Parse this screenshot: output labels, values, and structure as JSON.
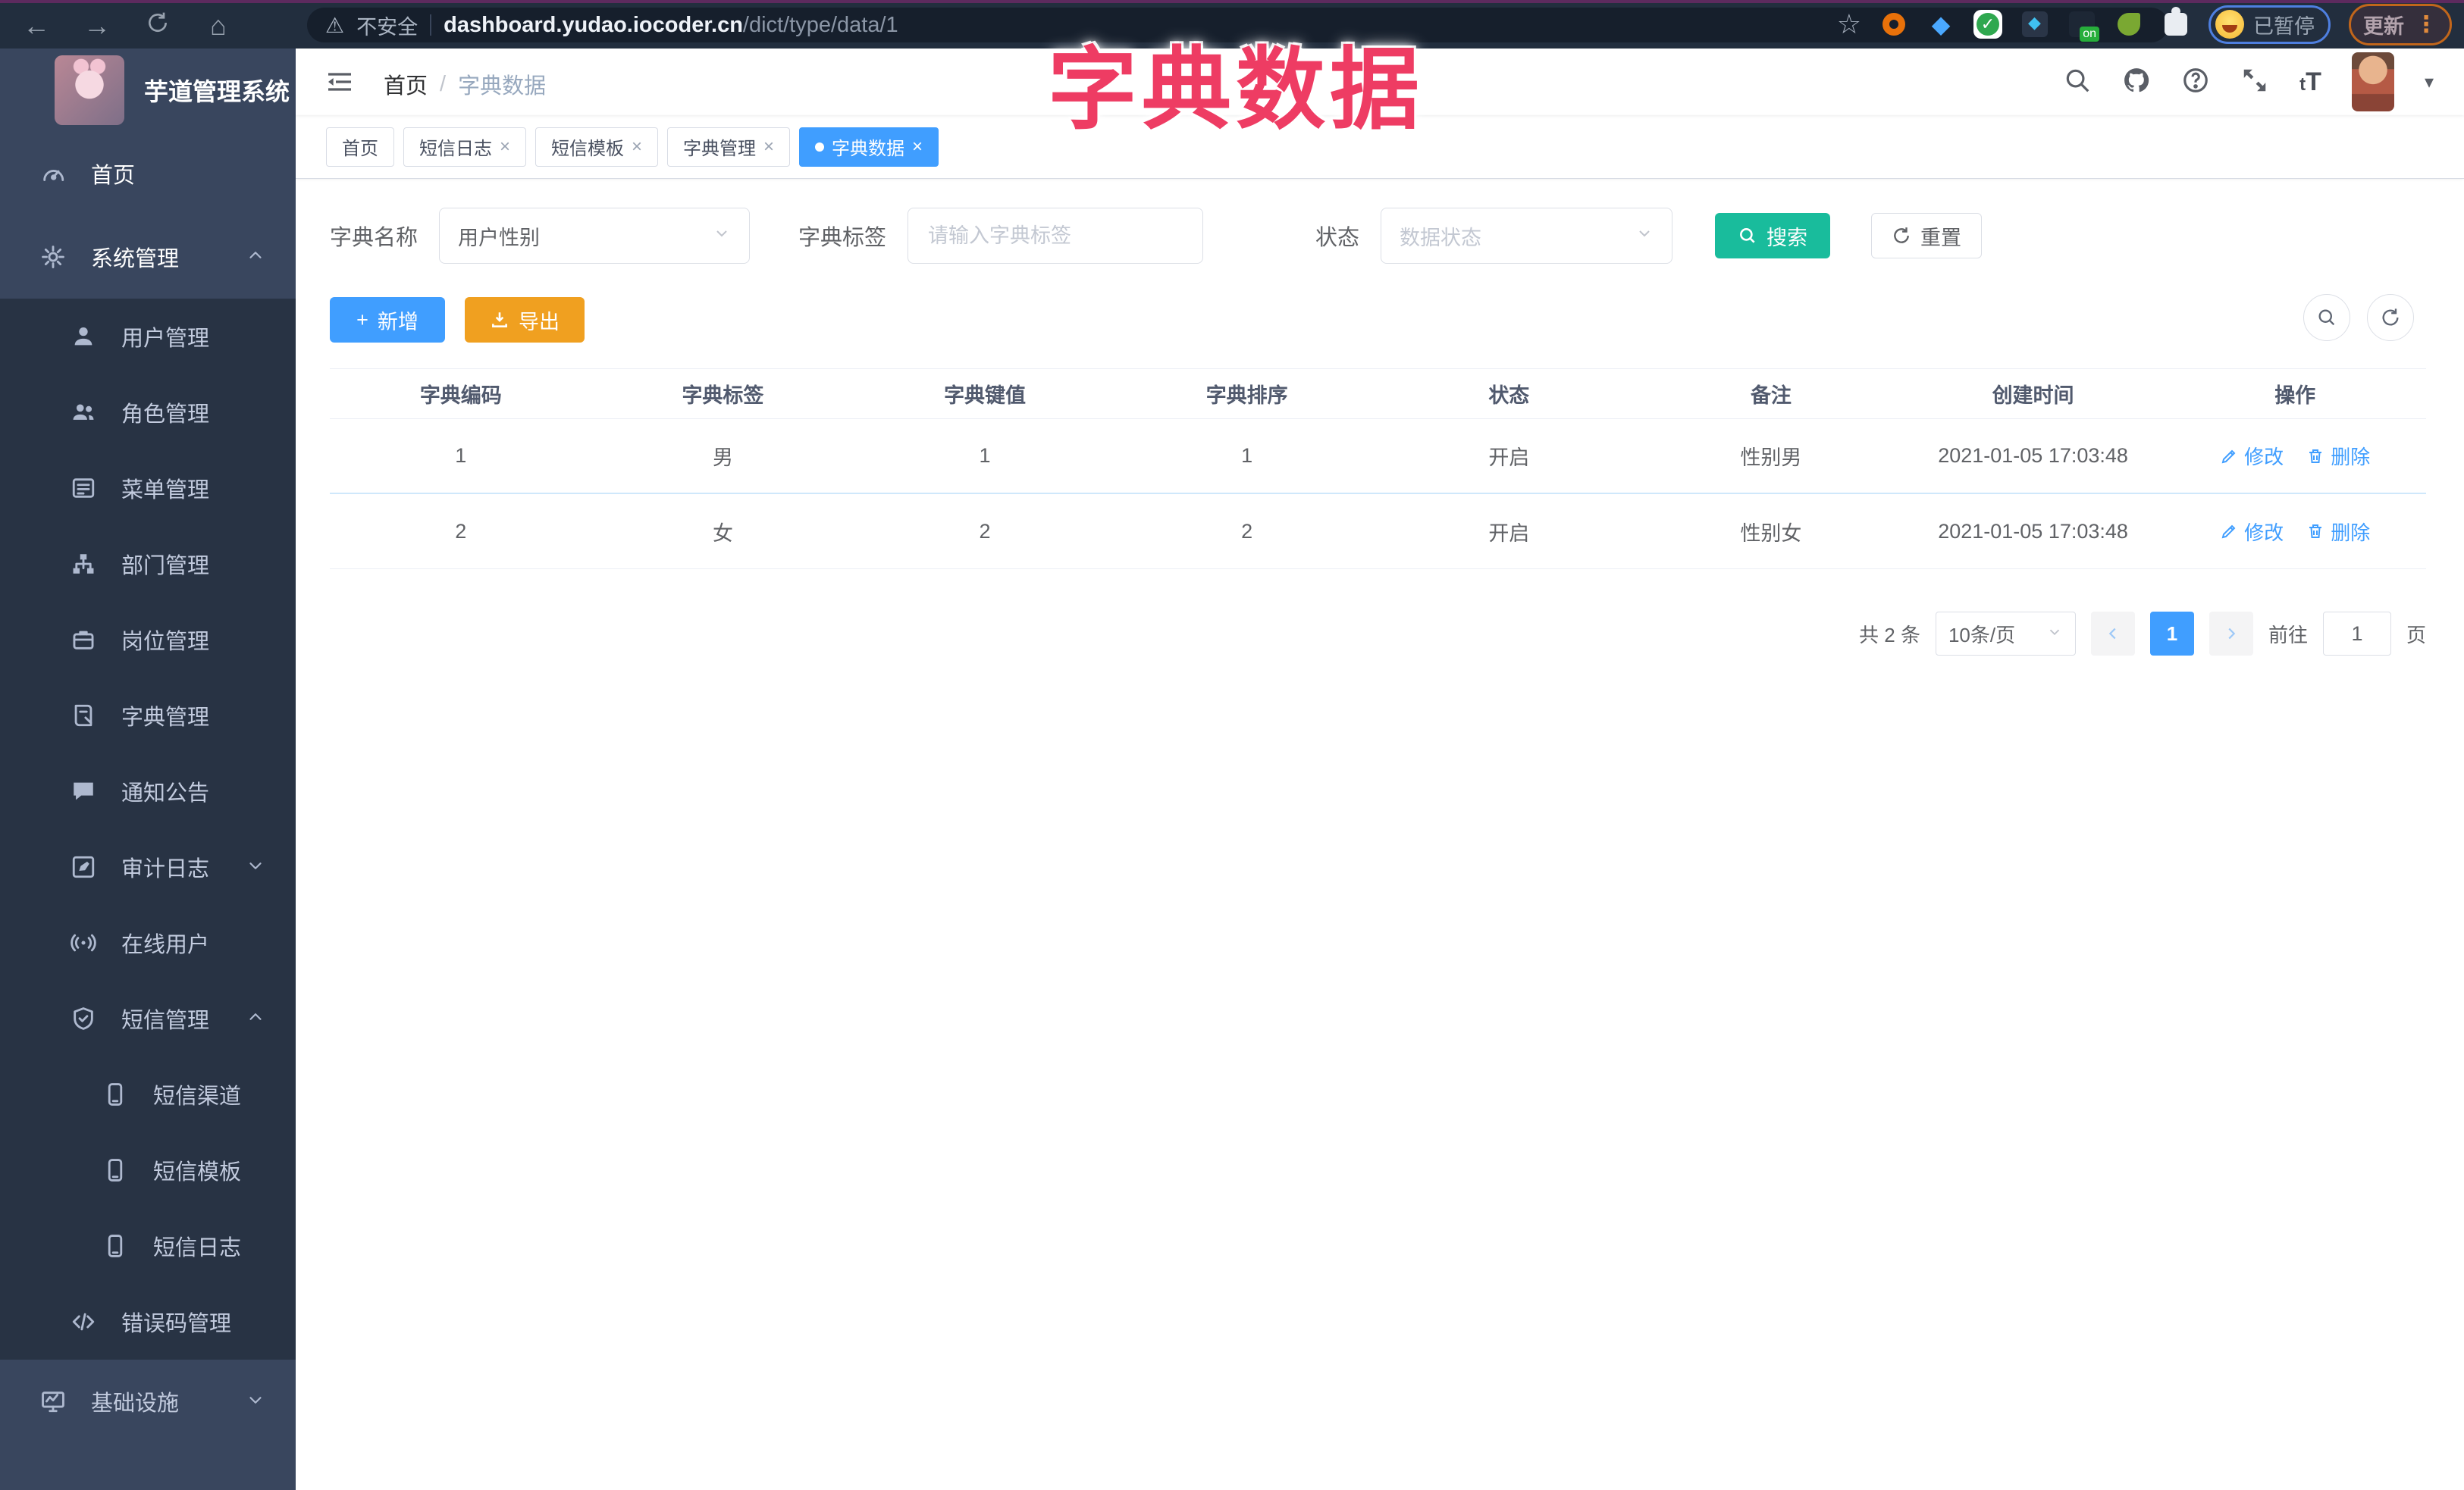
{
  "browser": {
    "security_label": "不安全",
    "url_host": "dashboard.yudao.iocoder.cn",
    "url_path": "/dict/type/data/1",
    "ext_badge": "on",
    "paused_label": "已暂停",
    "update_label": "更新",
    "update_dots": "⋮",
    "star": "☆",
    "back": "←",
    "forward": "→",
    "home": "⌂"
  },
  "overlay_title": "字典数据",
  "sidebar": {
    "logo_title": "芋道管理系统",
    "items": [
      {
        "label": "首页",
        "icon": "dashboard-icon",
        "level": 1,
        "section": "light",
        "bright": true
      },
      {
        "label": "系统管理",
        "icon": "gear-icon",
        "level": 1,
        "section": "light",
        "caret": "up",
        "bright": true
      },
      {
        "label": "用户管理",
        "icon": "user-icon",
        "level": 2,
        "section": "dark"
      },
      {
        "label": "角色管理",
        "icon": "users-icon",
        "level": 2,
        "section": "dark"
      },
      {
        "label": "菜单管理",
        "icon": "menu-list-icon",
        "level": 2,
        "section": "dark"
      },
      {
        "label": "部门管理",
        "icon": "org-tree-icon",
        "level": 2,
        "section": "dark"
      },
      {
        "label": "岗位管理",
        "icon": "badge-icon",
        "level": 2,
        "section": "dark"
      },
      {
        "label": "字典管理",
        "icon": "book-icon",
        "level": 2,
        "section": "dark"
      },
      {
        "label": "通知公告",
        "icon": "announcement-icon",
        "level": 2,
        "section": "dark"
      },
      {
        "label": "审计日志",
        "icon": "audit-log-icon",
        "level": 2,
        "section": "dark",
        "caret": "down"
      },
      {
        "label": "在线用户",
        "icon": "online-users-icon",
        "level": 2,
        "section": "dark"
      },
      {
        "label": "短信管理",
        "icon": "shield-check-icon",
        "level": 2,
        "section": "dark",
        "caret": "up"
      },
      {
        "label": "短信渠道",
        "icon": "phone-icon",
        "level": 3,
        "section": "dark"
      },
      {
        "label": "短信模板",
        "icon": "phone-icon",
        "level": 3,
        "section": "dark"
      },
      {
        "label": "短信日志",
        "icon": "phone-icon",
        "level": 3,
        "section": "dark"
      },
      {
        "label": "错误码管理",
        "icon": "code-icon",
        "level": 2,
        "section": "dark"
      },
      {
        "label": "基础设施",
        "icon": "monitor-icon",
        "level": 1,
        "section": "light",
        "caret": "down"
      }
    ]
  },
  "header": {
    "breadcrumb": {
      "home": "首页",
      "separator": "/",
      "current": "字典数据"
    }
  },
  "tabs": [
    {
      "label": "首页",
      "closable": false,
      "active": false
    },
    {
      "label": "短信日志",
      "closable": true,
      "active": false
    },
    {
      "label": "短信模板",
      "closable": true,
      "active": false
    },
    {
      "label": "字典管理",
      "closable": true,
      "active": false
    },
    {
      "label": "字典数据",
      "closable": true,
      "active": true
    }
  ],
  "filters": {
    "dict_name_label": "字典名称",
    "dict_name_value": "用户性别",
    "dict_label_label": "字典标签",
    "dict_label_placeholder": "请输入字典标签",
    "status_label": "状态",
    "status_placeholder": "数据状态",
    "search_label": "搜索",
    "reset_label": "重置"
  },
  "toolbar": {
    "add_label": "新增",
    "export_label": "导出",
    "plus": "+"
  },
  "table": {
    "headers": [
      "字典编码",
      "字典标签",
      "字典键值",
      "字典排序",
      "状态",
      "备注",
      "创建时间",
      "操作"
    ],
    "rows": [
      [
        "1",
        "男",
        "1",
        "1",
        "开启",
        "性别男",
        "2021-01-05 17:03:48"
      ],
      [
        "2",
        "女",
        "2",
        "2",
        "开启",
        "性别女",
        "2021-01-05 17:03:48"
      ]
    ],
    "edit_label": "修改",
    "delete_label": "删除"
  },
  "pagination": {
    "total_text": "共 2 条",
    "page_size": "10条/页",
    "current_page": "1",
    "goto_label": "前往",
    "goto_value": "1",
    "page_unit": "页"
  },
  "ui": {
    "close": "×"
  },
  "colors": {
    "accent_blue": "#409eff",
    "search_teal": "#19bc9c",
    "export_orange": "#f0a020",
    "overlay_pink": "#ee3c63",
    "sidebar_bg": "#39465e",
    "submenu_bg": "#283344"
  }
}
